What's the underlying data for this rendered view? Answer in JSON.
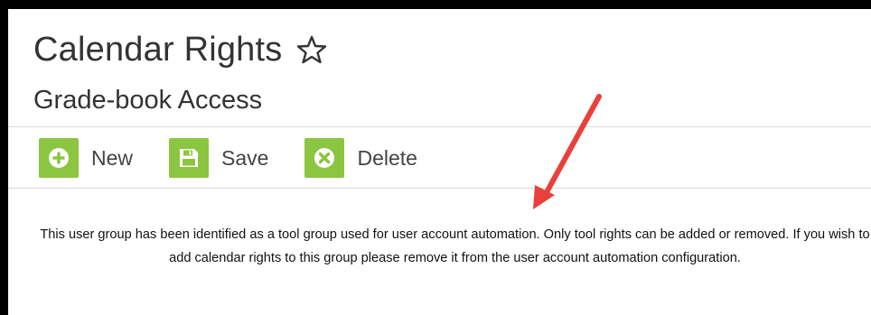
{
  "header": {
    "title": "Calendar Rights",
    "subtitle": "Grade-book Access"
  },
  "toolbar": {
    "new_label": "New",
    "save_label": "Save",
    "delete_label": "Delete"
  },
  "message": {
    "text": "This user group has been identified as a tool group used for user account automation. Only tool rights can be added or removed. If you wish to add calendar rights to this group please remove it from the user account automation configuration."
  },
  "colors": {
    "accent_green": "#8cc53f",
    "annotation_arrow": "#e8413c",
    "frame": "#000000"
  },
  "icons": {
    "favorite": "star-icon",
    "new": "plus-circle-icon",
    "save": "floppy-disk-icon",
    "delete": "x-circle-icon"
  }
}
